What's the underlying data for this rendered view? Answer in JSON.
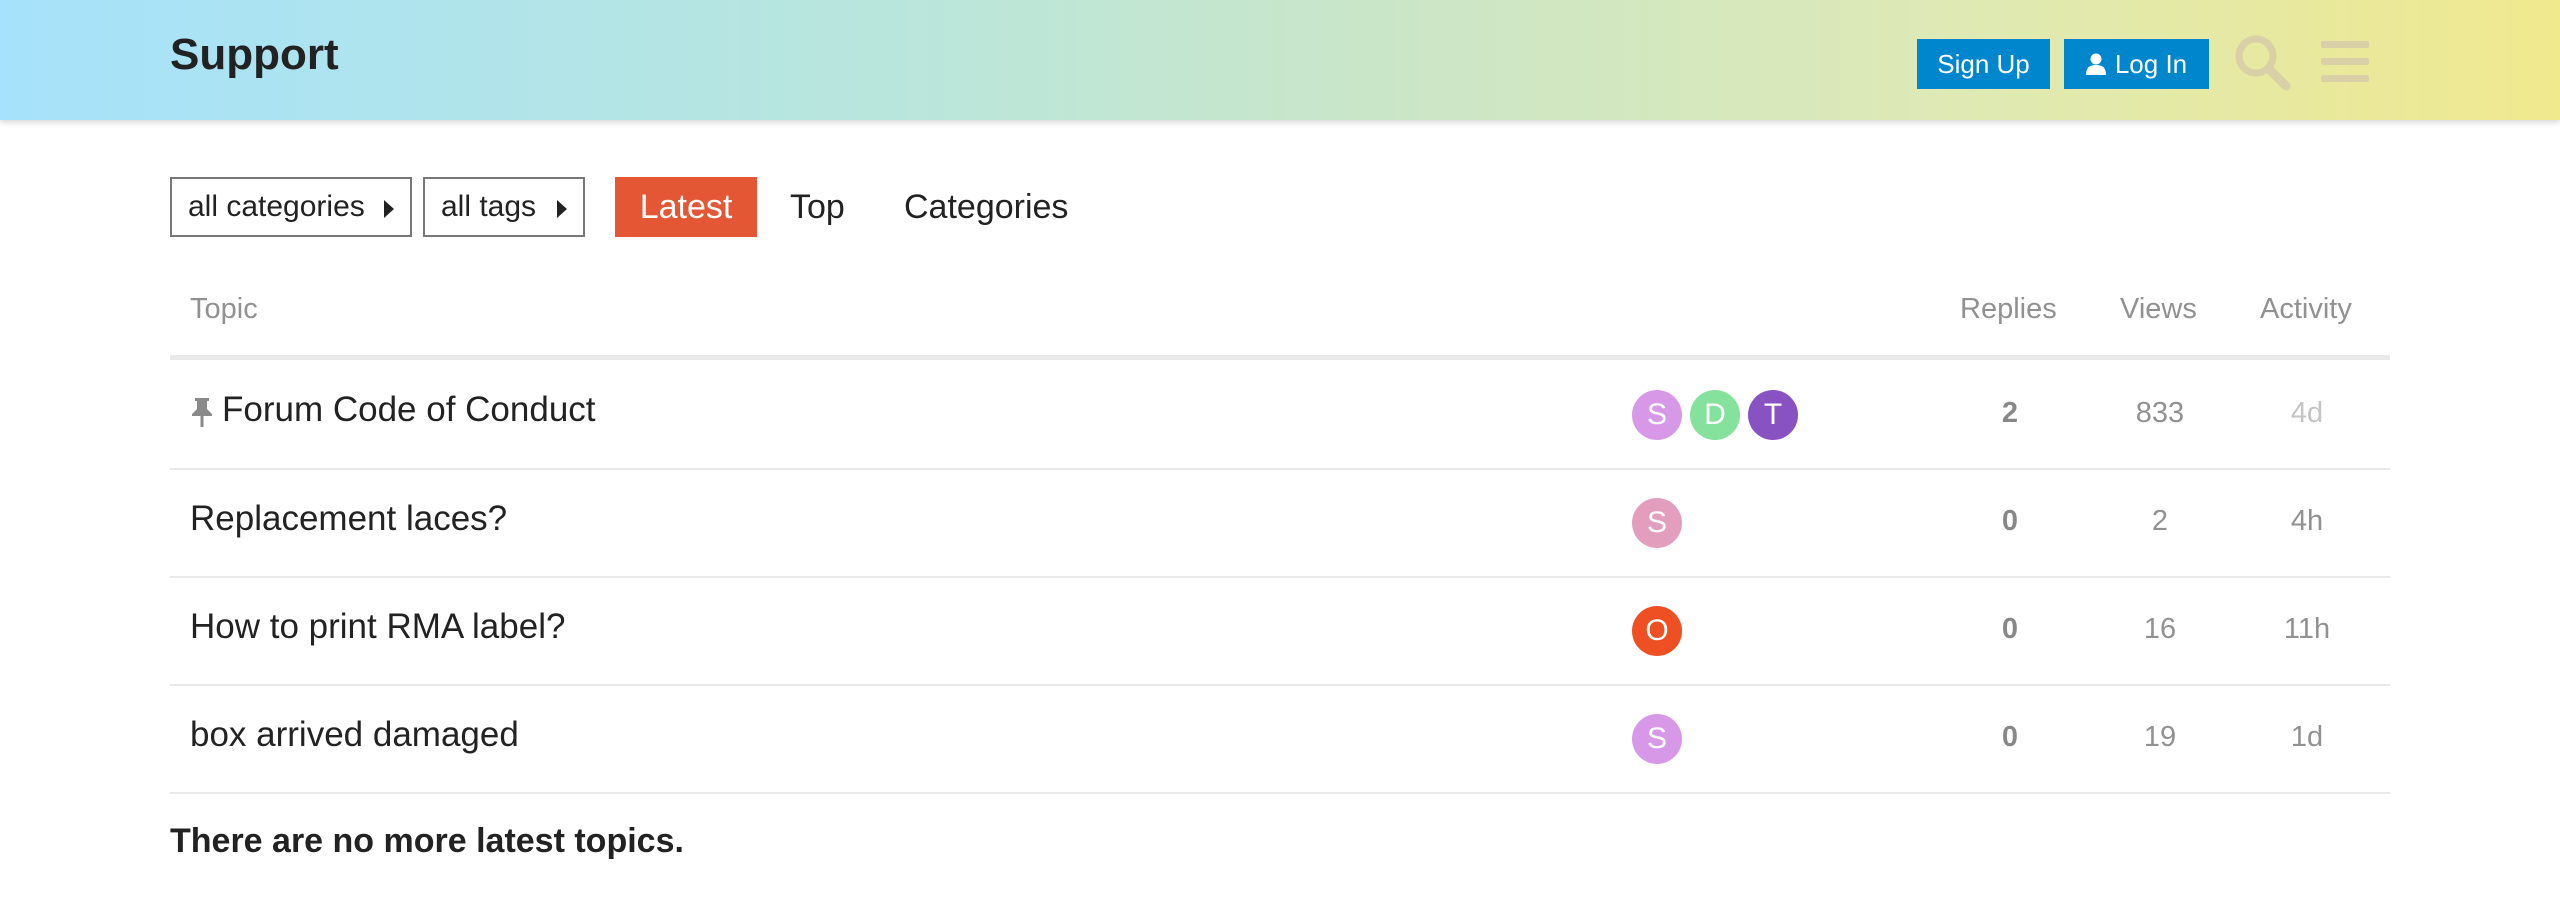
{
  "header": {
    "title": "Support",
    "signup_label": "Sign Up",
    "login_label": "Log In",
    "gradient_colors": [
      "#a6e2fb",
      "#f0e98e"
    ],
    "button_color": "#0086cc"
  },
  "nav": {
    "category_dropdown": "all categories",
    "tags_dropdown": "all tags",
    "tabs": [
      {
        "label": "Latest",
        "active": true
      },
      {
        "label": "Top",
        "active": false
      },
      {
        "label": "Categories",
        "active": false
      }
    ],
    "active_color": "#e45735"
  },
  "table": {
    "columns": {
      "topic": "Topic",
      "replies": "Replies",
      "views": "Views",
      "activity": "Activity"
    },
    "rows": [
      {
        "title": "Forum Code of Conduct",
        "pinned": true,
        "posters": [
          {
            "letter": "S",
            "color": "#d898e8"
          },
          {
            "letter": "D",
            "color": "#84e29c"
          },
          {
            "letter": "T",
            "color": "#8952c3"
          }
        ],
        "replies": "2",
        "views": "833",
        "activity": "4d"
      },
      {
        "title": "Replacement laces?",
        "pinned": false,
        "posters": [
          {
            "letter": "S",
            "color": "#e49ebd"
          }
        ],
        "replies": "0",
        "views": "2",
        "activity": "4h"
      },
      {
        "title": "How to print RMA label?",
        "pinned": false,
        "posters": [
          {
            "letter": "O",
            "color": "#ee4f23"
          }
        ],
        "replies": "0",
        "views": "16",
        "activity": "11h"
      },
      {
        "title": "box arrived damaged",
        "pinned": false,
        "posters": [
          {
            "letter": "S",
            "color": "#d898e8"
          }
        ],
        "replies": "0",
        "views": "19",
        "activity": "1d"
      }
    ]
  },
  "footer": {
    "message": "There are no more latest topics."
  }
}
